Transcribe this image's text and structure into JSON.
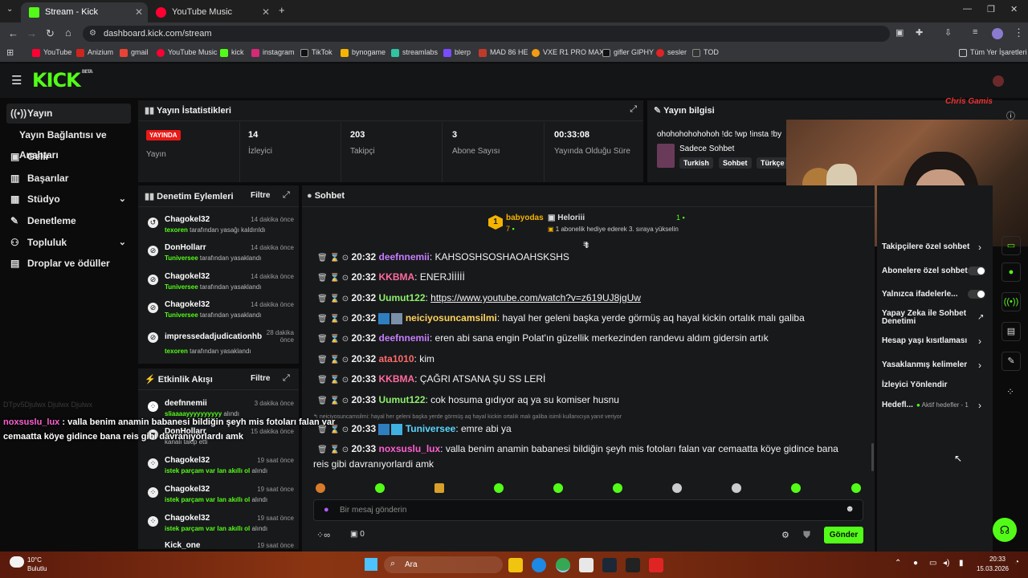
{
  "browser": {
    "tabs": [
      {
        "title": "Stream - Kick Dashboard",
        "active": true
      },
      {
        "title": "YouTube Music",
        "active": false
      }
    ],
    "url": "dashboard.kick.com/stream",
    "bookmarks": [
      "YouTube",
      "Anizium",
      "gmail",
      "YouTube Music",
      "kick",
      "instagram",
      "TikTok",
      "bynogame",
      "streamlabs",
      "blerp",
      "MAD 86 HE",
      "VXE R1 PRO MAX",
      "gifler GIPHY",
      "sesler",
      "TOD"
    ],
    "all_bookmarks": "Tüm Yer İşaretleri"
  },
  "kick": {
    "logo": "KICK",
    "beta": "BETA",
    "sidebar": {
      "items": [
        {
          "label": "Yayın",
          "icon": "broadcast-icon"
        },
        {
          "label": "Yayın Bağlantısı ve Anahtarı",
          "icon": ""
        },
        {
          "label": "Gelir",
          "icon": "wallet-icon"
        },
        {
          "label": "Başarılar",
          "icon": "trophy-icon"
        },
        {
          "label": "Stüdyo",
          "icon": "studio-icon"
        },
        {
          "label": "Denetleme",
          "icon": "wrench-icon"
        },
        {
          "label": "Topluluk",
          "icon": "community-icon"
        },
        {
          "label": "Droplar ve ödüller",
          "icon": "gift-icon"
        }
      ]
    },
    "stats": {
      "title": "Yayın İstatistikleri",
      "live_badge": "YAYINDA",
      "live_label": "Yayın",
      "viewers": "14",
      "viewers_label": "İzleyici",
      "followers": "203",
      "followers_label": "Takipçi",
      "subs": "3",
      "subs_label": "Abone Sayısı",
      "uptime": "00:33:08",
      "uptime_label": "Yayında Olduğu Süre"
    },
    "info": {
      "title": "Yayın bilgisi",
      "stream_title": "ohohohohohohoh !dc !wp !insta !by",
      "category": "Sadece Sohbet",
      "tags": [
        "Turkish",
        "Sohbet",
        "Türkçe"
      ]
    },
    "modlog": {
      "title": "Denetim Eylemleri",
      "filter": "Filtre",
      "entries": [
        {
          "user": "Chagokel32",
          "time": "14 dakika önce",
          "actor": "texoren",
          "action": " tarafından yasağı kaldırıldı"
        },
        {
          "user": "DonHollarr",
          "time": "14 dakika önce",
          "actor": "Tuniversee",
          "action": " tarafından yasaklandı"
        },
        {
          "user": "Chagokel32",
          "time": "14 dakika önce",
          "actor": "Tuniversee",
          "action": " tarafından yasaklandı"
        },
        {
          "user": "Chagokel32",
          "time": "14 dakika önce",
          "actor": "Tuniversee",
          "action": " tarafından yasaklandı"
        },
        {
          "user": "impressedadjudicationhb",
          "time": "28 dakika önce",
          "actor": "texoren",
          "action": " tarafından yasaklandı"
        }
      ]
    },
    "activity": {
      "title": "Etkinlik Akışı",
      "filter": "Filtre",
      "entries": [
        {
          "user": "deefnnemii",
          "time": "3 dakika önce",
          "detail": "sliaaaayyyyyyyyyy",
          "suffix": " alındı"
        },
        {
          "user": "DonHollarr",
          "time": "15 dakika önce",
          "detail": "",
          "suffix": "kanalı takip etti"
        },
        {
          "user": "Chagokel32",
          "time": "19 saat önce",
          "detail": "istek parçam var lan akıllı ol",
          "suffix": " alındı"
        },
        {
          "user": "Chagokel32",
          "time": "19 saat önce",
          "detail": "istek parçam var lan akıllı ol",
          "suffix": " alındı"
        },
        {
          "user": "Chagokel32",
          "time": "19 saat önce",
          "detail": "istek parçam var lan akıllı ol",
          "suffix": " alındı"
        },
        {
          "user": "Kick_one",
          "time": "19 saat önce",
          "detail": "",
          "suffix": ""
        }
      ]
    },
    "chat": {
      "title": "Sohbet",
      "gifter": "babyodas",
      "gifter_count": "7",
      "recipient": "Heloriii",
      "recipient_count": "1",
      "gift_text": "1 abonelik hediye ederek 3. sıraya yükselin",
      "messages": [
        {
          "time": "20:32",
          "user": "deefnnemii",
          "color": "#c77dff",
          "text": "KAHSOSHSOSHAOAHSKSHS"
        },
        {
          "time": "20:32",
          "user": "KKBMA",
          "color": "#ff6aa0",
          "text": "ENERJİİİİİ"
        },
        {
          "time": "20:32",
          "user": "Uumut122",
          "color": "#8df06a",
          "text": "https://www.youtube.com/watch?v=z619UJ8jgUw"
        },
        {
          "time": "20:32",
          "user": "neiciyosuncamsilmi",
          "color": "#ffd35c",
          "text": "hayal her geleni başka yerde görmüş aq hayal kickin ortalık malı galiba"
        },
        {
          "time": "20:32",
          "user": "deefnnemii",
          "color": "#c77dff",
          "text": "eren abi sana engin Polat'ın güzellik merkezinden randevu aldım gidersin artık"
        },
        {
          "time": "20:32",
          "user": "ata1010",
          "color": "#ff6b6b",
          "text": "kim"
        },
        {
          "time": "20:33",
          "user": "KKBMA",
          "color": "#ff6aa0",
          "text": "ÇAĞRI ATSANA ŞU SS LERİ"
        },
        {
          "time": "20:33",
          "user": "Uumut122",
          "color": "#8df06a",
          "text": "cok hosuma gıdıyor aq ya su komiser husnu"
        }
      ],
      "reply_context": "neiciyosuncamsilmi: hayal her geleni başka yerde görmüş aq hayal kickin ortalık malı galiba isimli kullanıcıya yanıt veriyor",
      "reply_msg": {
        "time": "20:33",
        "user": "Tuniversee",
        "color": "#5ad7ff",
        "text": "emre abi ya"
      },
      "last_msg": {
        "time": "20:33",
        "user": "noxsuslu_lux",
        "color": "#ff5fd2",
        "text": "valla benim anamin babanesi bildiğin şeyh mis fotoları falan var cemaatta köye gidince bana",
        "text2": "reis gibi davranıyorlardi amk"
      },
      "overlay_user": "noxsuslu_lux",
      "overlay_text": "valla benim anamin babanesi bildiğin şeyh mis fotoları falan var",
      "overlay_text2": "cemaatta köye gidince bana reis gibi davranıyorlardı amk",
      "overlay_faded": "DTpv5Djulwx Djulwx Djulwx",
      "input_placeholder": "Bir mesaj gönderin",
      "points": "0",
      "send_label": "Gönder"
    },
    "settings": {
      "items": [
        {
          "label": "Takipçilere özel sohbet",
          "kind": "chevron"
        },
        {
          "label": "Abonelere özel sohbet",
          "kind": "toggle"
        },
        {
          "label": "Yalnızca ifadelerle...",
          "kind": "toggle"
        },
        {
          "label": "Yapay Zeka ile Sohbet Denetimi",
          "kind": "link"
        },
        {
          "label": "Hesap yaşı kısıtlaması",
          "kind": "chevron"
        },
        {
          "label": "Yasaklanmış kelimeler",
          "kind": "chevron"
        },
        {
          "label": "İzleyici Yönlendir",
          "kind": "none"
        },
        {
          "label": "Hedefl...",
          "kind": "chevron"
        }
      ],
      "goals_note": "Aktif hedefler - 1"
    },
    "webcam_caption": "Chris Gamis"
  },
  "taskbar": {
    "weather_temp": "10°C",
    "weather_desc": "Bulutlu",
    "search": "Ara",
    "time": "20:33",
    "date": "15.03.2026"
  },
  "colors": {
    "kick_green": "#53fc18",
    "live_red": "#e91916",
    "panel": "#18191b"
  }
}
